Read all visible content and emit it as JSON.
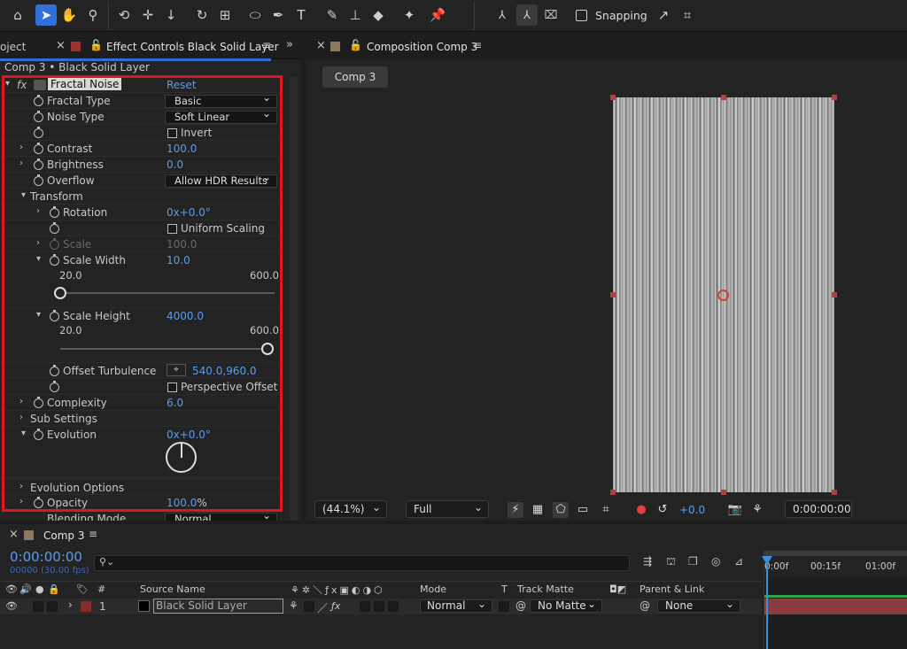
{
  "toolbar": {
    "snapping_label": "Snapping",
    "icons": [
      "home-icon",
      "selection-icon",
      "hand-icon",
      "zoom-icon",
      "orbit-icon",
      "move-icon",
      "dolly-icon",
      "rotate-icon",
      "anchor-icon",
      "rectangle-icon",
      "pen-icon",
      "type-icon",
      "brush-icon",
      "clone-stamp-icon",
      "eraser-icon",
      "roto-brush-icon",
      "puppet-pin-icon"
    ]
  },
  "left_panel": {
    "project_tab": "oject",
    "tab_title": "Effect Controls Black Solid Layer",
    "breadcrumb": "Comp 3 • Black Solid Layer",
    "effect_name": "Fractal Noise",
    "reset_label": "Reset",
    "fx_label": "fx",
    "props": {
      "fractal_type": {
        "label": "Fractal Type",
        "value": "Basic"
      },
      "noise_type": {
        "label": "Noise Type",
        "value": "Soft Linear"
      },
      "invert": {
        "label": "Invert"
      },
      "contrast": {
        "label": "Contrast",
        "value": "100.0"
      },
      "brightness": {
        "label": "Brightness",
        "value": "0.0"
      },
      "overflow": {
        "label": "Overflow",
        "value": "Allow HDR Results"
      },
      "transform": {
        "label": "Transform"
      },
      "rotation": {
        "label": "Rotation",
        "value_prefix": "0x",
        "value_suffix": "+0.0°"
      },
      "uniform_scaling": {
        "label": "Uniform Scaling"
      },
      "scale": {
        "label": "Scale",
        "value": "100.0"
      },
      "scale_width": {
        "label": "Scale Width",
        "value": "10.0",
        "min": "20.0",
        "max": "600.0",
        "slider_fraction": 0.0
      },
      "scale_height": {
        "label": "Scale Height",
        "value": "4000.0",
        "min": "20.0",
        "max": "600.0",
        "slider_fraction": 1.0
      },
      "offset_turbulence": {
        "label": "Offset Turbulence",
        "value": "540.0,960.0"
      },
      "perspective_offset": {
        "label": "Perspective Offset"
      },
      "complexity": {
        "label": "Complexity",
        "value": "6.0"
      },
      "sub_settings": {
        "label": "Sub Settings"
      },
      "evolution": {
        "label": "Evolution",
        "value_prefix": "0x",
        "value_suffix": "+0.0°"
      },
      "evolution_options": {
        "label": "Evolution Options"
      },
      "opacity": {
        "label": "Opacity",
        "value": "100.0",
        "unit": "%"
      },
      "blending_mode": {
        "label": "Blending Mode",
        "value": "Normal"
      }
    }
  },
  "viewer": {
    "tab_title": "Composition Comp 3",
    "comp_button": "Comp 3",
    "zoom": "(44.1%)",
    "resolution": "Full",
    "exposure": "+0.0",
    "timecode": "0:00:00:00"
  },
  "timeline": {
    "tab_title": "Comp 3",
    "current_time": "0:00:00:00",
    "frames_fps": "00000 (30.00 fps)",
    "ruler": [
      "0:00f",
      "00:15f",
      "01:00f"
    ],
    "columns": {
      "number": "#",
      "source_name": "Source Name",
      "mode": "Mode",
      "t": "T",
      "track_matte": "Track Matte",
      "parent_link": "Parent & Link"
    },
    "layer": {
      "index": "1",
      "name": "Black Solid Layer",
      "mode": "Normal",
      "track_matte": "No Matte",
      "parent": "None"
    }
  },
  "colors": {
    "accent": "#2f6fd6",
    "value_blue": "#5a9cf0",
    "highlight_box": "#e0161e",
    "layer_bar": "#8a3c40",
    "playhead": "#3b8de0"
  }
}
